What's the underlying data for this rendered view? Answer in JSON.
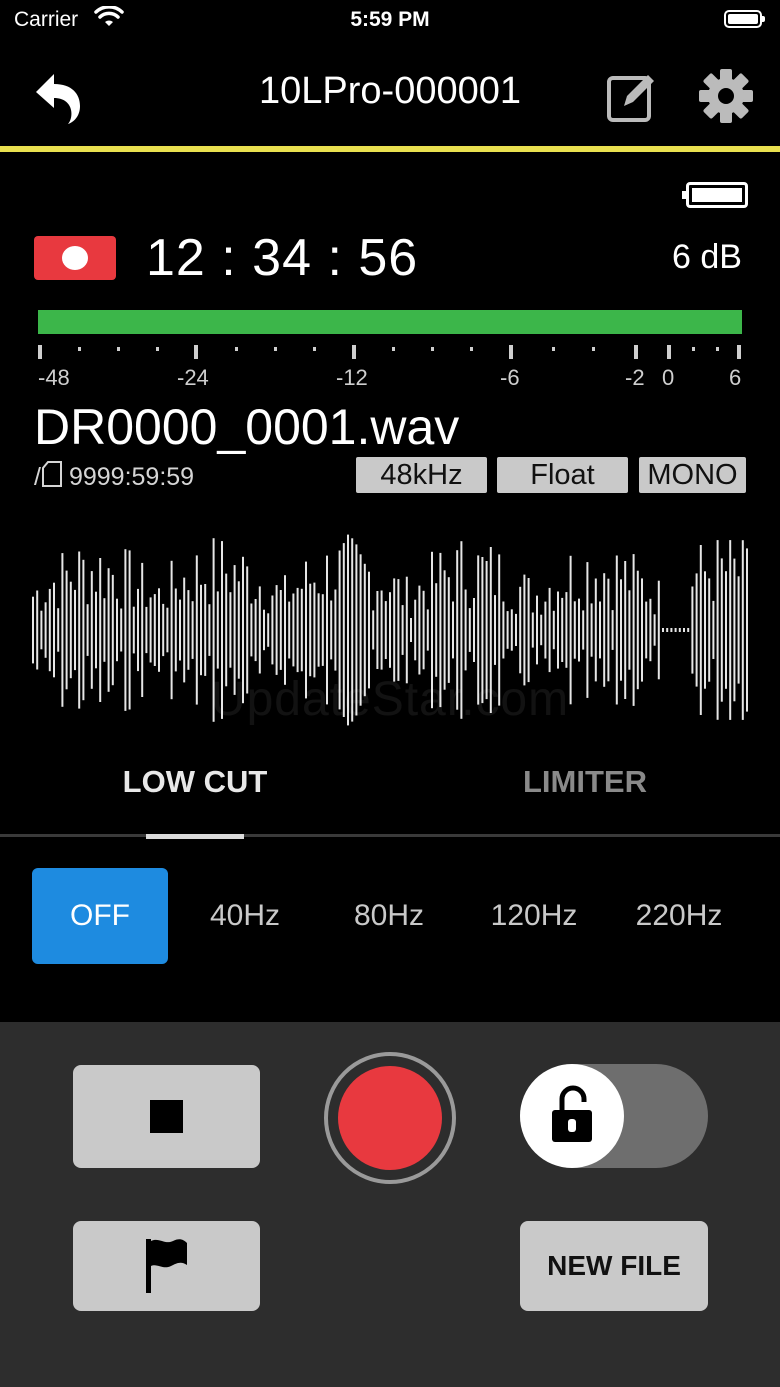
{
  "status_bar": {
    "carrier": "Carrier",
    "time": "5:59 PM"
  },
  "nav": {
    "title": "10LPro-000001",
    "back_icon": "undo-arrow-icon",
    "edit_icon": "edit-icon",
    "settings_icon": "gear-icon"
  },
  "colors": {
    "accent_yellow": "#e9e04f",
    "rec_red": "#e8393f",
    "meter_green": "#3cb64a",
    "active_blue": "#1e8be0"
  },
  "recorder": {
    "timer": "12 : 34 : 56",
    "level_db": "6 dB",
    "meter_level_fraction": 1.0,
    "meter_ticks": [
      "-48",
      "-24",
      "-12",
      "-6",
      "-2",
      "0",
      "6"
    ]
  },
  "file": {
    "name": "DR0000_0001.wav",
    "sd_prefix": "/",
    "remaining": "9999:59:59",
    "badges": [
      "48kHz",
      "Float",
      "MONO"
    ]
  },
  "watermark": "UpdateStar.com",
  "tabs": [
    {
      "label": "LOW CUT",
      "selected": true
    },
    {
      "label": "LIMITER",
      "selected": false
    }
  ],
  "lowcut_options": [
    {
      "label": "OFF",
      "selected": true
    },
    {
      "label": "40Hz",
      "selected": false
    },
    {
      "label": "80Hz",
      "selected": false
    },
    {
      "label": "120Hz",
      "selected": false
    },
    {
      "label": "220Hz",
      "selected": false
    }
  ],
  "controls": {
    "stop_icon": "stop-icon",
    "record_icon": "record-icon",
    "lock_icon": "unlock-icon",
    "lock_state": "unlocked",
    "mark_icon": "flag-icon",
    "new_file_label": "NEW FILE"
  }
}
